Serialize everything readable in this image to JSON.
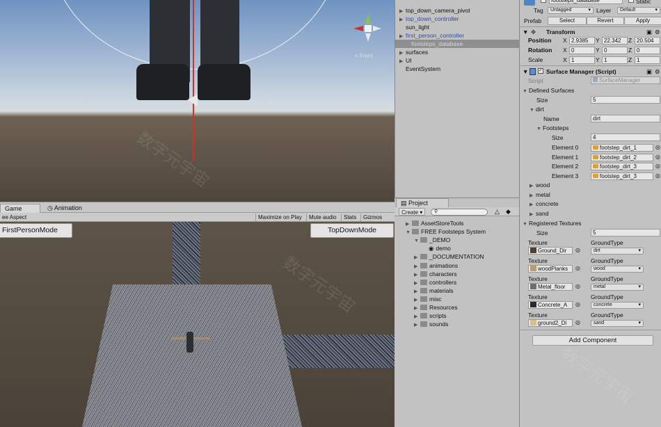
{
  "colors": {
    "selection": "#8f8f8f",
    "prefab_blue": "#2d4fa8",
    "red_axis": "#d0302a",
    "folder": "#e0a030"
  },
  "scene": {
    "gizmo_label": "< Front"
  },
  "game": {
    "tab_game": "Game",
    "tab_animation": "Animation",
    "aspect": "ee Aspect",
    "maximize": "Maximize on Play",
    "mute": "Mute audio",
    "stats": "Stats",
    "gizmos": "Gizmos",
    "btn_left": "FirstPersonMode",
    "btn_right": "TopDownMode"
  },
  "hierarchy": {
    "items": [
      {
        "label": "top_down_camera_pivot",
        "arrow": true,
        "blue": false
      },
      {
        "label": "top_down_controller",
        "arrow": true,
        "blue": true
      },
      {
        "label": "sun_light",
        "arrow": false,
        "blue": false
      },
      {
        "label": "first_person_controller",
        "arrow": true,
        "blue": true
      },
      {
        "label": "footsteps_database",
        "arrow": false,
        "blue": false,
        "selected": true
      },
      {
        "label": "surfaces",
        "arrow": true,
        "blue": false
      },
      {
        "label": "UI",
        "arrow": true,
        "blue": false
      },
      {
        "label": "EventSystem",
        "arrow": false,
        "blue": false
      }
    ]
  },
  "project": {
    "tab": "Project",
    "create": "Create",
    "items": [
      {
        "label": "AssetStoreTools",
        "level": 0
      },
      {
        "label": "FREE Footsteps System",
        "level": 0
      },
      {
        "label": "_DEMO",
        "level": 1
      },
      {
        "label": "demo",
        "level": 2
      },
      {
        "label": "_DOCUMENTATION",
        "level": 1
      },
      {
        "label": "animations",
        "level": 1
      },
      {
        "label": "characters",
        "level": 1
      },
      {
        "label": "controllers",
        "level": 1
      },
      {
        "label": "materials",
        "level": 1
      },
      {
        "label": "misc",
        "level": 1
      },
      {
        "label": "Resources",
        "level": 1
      },
      {
        "label": "scripts",
        "level": 1
      },
      {
        "label": "sounds",
        "level": 1
      }
    ]
  },
  "inspector": {
    "object_name": "footsteps_database",
    "static": "Static",
    "tag_label": "Tag",
    "tag_value": "Untagged",
    "layer_label": "Layer",
    "layer_value": "Default",
    "prefab_label": "Prefab",
    "select": "Select",
    "revert": "Revert",
    "apply": "Apply",
    "transform": "Transform",
    "position": "Position",
    "rotation": "Rotation",
    "scale": "Scale",
    "pos": [
      "2.9385",
      "22.342",
      "20.504"
    ],
    "rot": [
      "0",
      "0",
      "0"
    ],
    "scl": [
      "1",
      "1",
      "1"
    ],
    "axis": [
      "X",
      "Y",
      "Z"
    ],
    "surface_manager": "Surface Manager (Script)",
    "script_label": "Script",
    "script_value": "SurfaceManager",
    "defined_surfaces": "Defined Surfaces",
    "size_label": "Size",
    "size_value": "5",
    "dirt": "dirt",
    "name_label": "Name",
    "name_value": "dirt",
    "footsteps": "Footsteps",
    "footsteps_size": "4",
    "elements": [
      {
        "label": "Element 0",
        "value": "footstep_dirt_1"
      },
      {
        "label": "Element 1",
        "value": "footstep_dirt_2"
      },
      {
        "label": "Element 2",
        "value": "footstep_dirt_3"
      },
      {
        "label": "Element 3",
        "value": "footstep_dirt_3"
      }
    ],
    "surfaces": [
      "wood",
      "metal",
      "concrete",
      "sand"
    ],
    "registered_textures": "Registered Textures",
    "reg_size": "5",
    "texture_label": "Texture",
    "groundtype_label": "GroundType",
    "textures": [
      {
        "tex": "Ground_Dir",
        "type": "dirt",
        "swatch": "#4b4038"
      },
      {
        "tex": "woodPlanks",
        "type": "wood",
        "swatch": "#b89c72"
      },
      {
        "tex": "Metal_floor",
        "type": "metal",
        "swatch": "#6e6e6e"
      },
      {
        "tex": "Concrete_A",
        "type": "concrete",
        "swatch": "#2a2a2a"
      },
      {
        "tex": "ground2_Di",
        "type": "sand",
        "swatch": "#d8c08a"
      }
    ],
    "add_component": "Add Component"
  }
}
